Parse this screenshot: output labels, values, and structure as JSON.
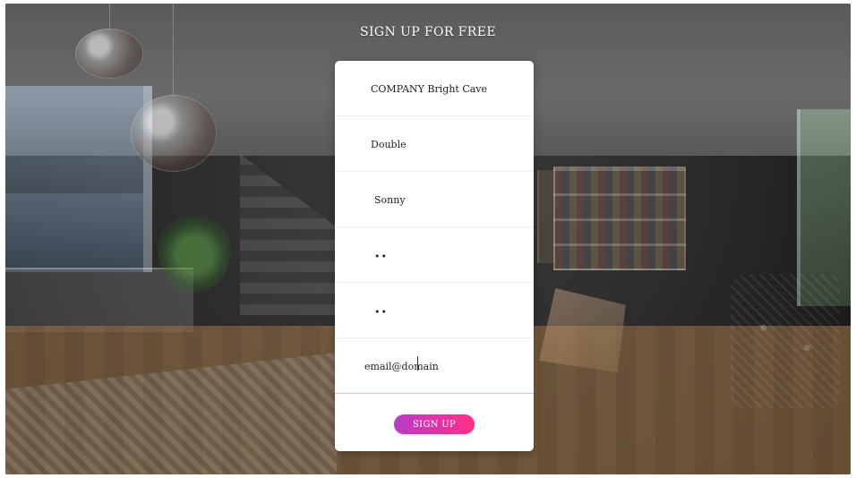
{
  "page": {
    "title": "SIGN UP FOR FREE"
  },
  "form": {
    "fields": [
      {
        "name": "company-name",
        "value": "COMPANY Bright Cave",
        "placeholder": ""
      },
      {
        "name": "first-name",
        "value": "Double",
        "placeholder": ""
      },
      {
        "name": "last-name",
        "value": "Sonny",
        "placeholder": ""
      },
      {
        "name": "password",
        "value": "••",
        "placeholder": ""
      },
      {
        "name": "confirm-password",
        "value": "••",
        "placeholder": ""
      },
      {
        "name": "email-address",
        "value": "email@domain",
        "placeholder": ""
      }
    ],
    "submit_label": "SIGN UP"
  },
  "colors": {
    "button_gradient_start": "#b83cc8",
    "button_gradient_end": "#ff2e86",
    "panel_bg": "#ffffff",
    "title_text": "#ffffff"
  }
}
